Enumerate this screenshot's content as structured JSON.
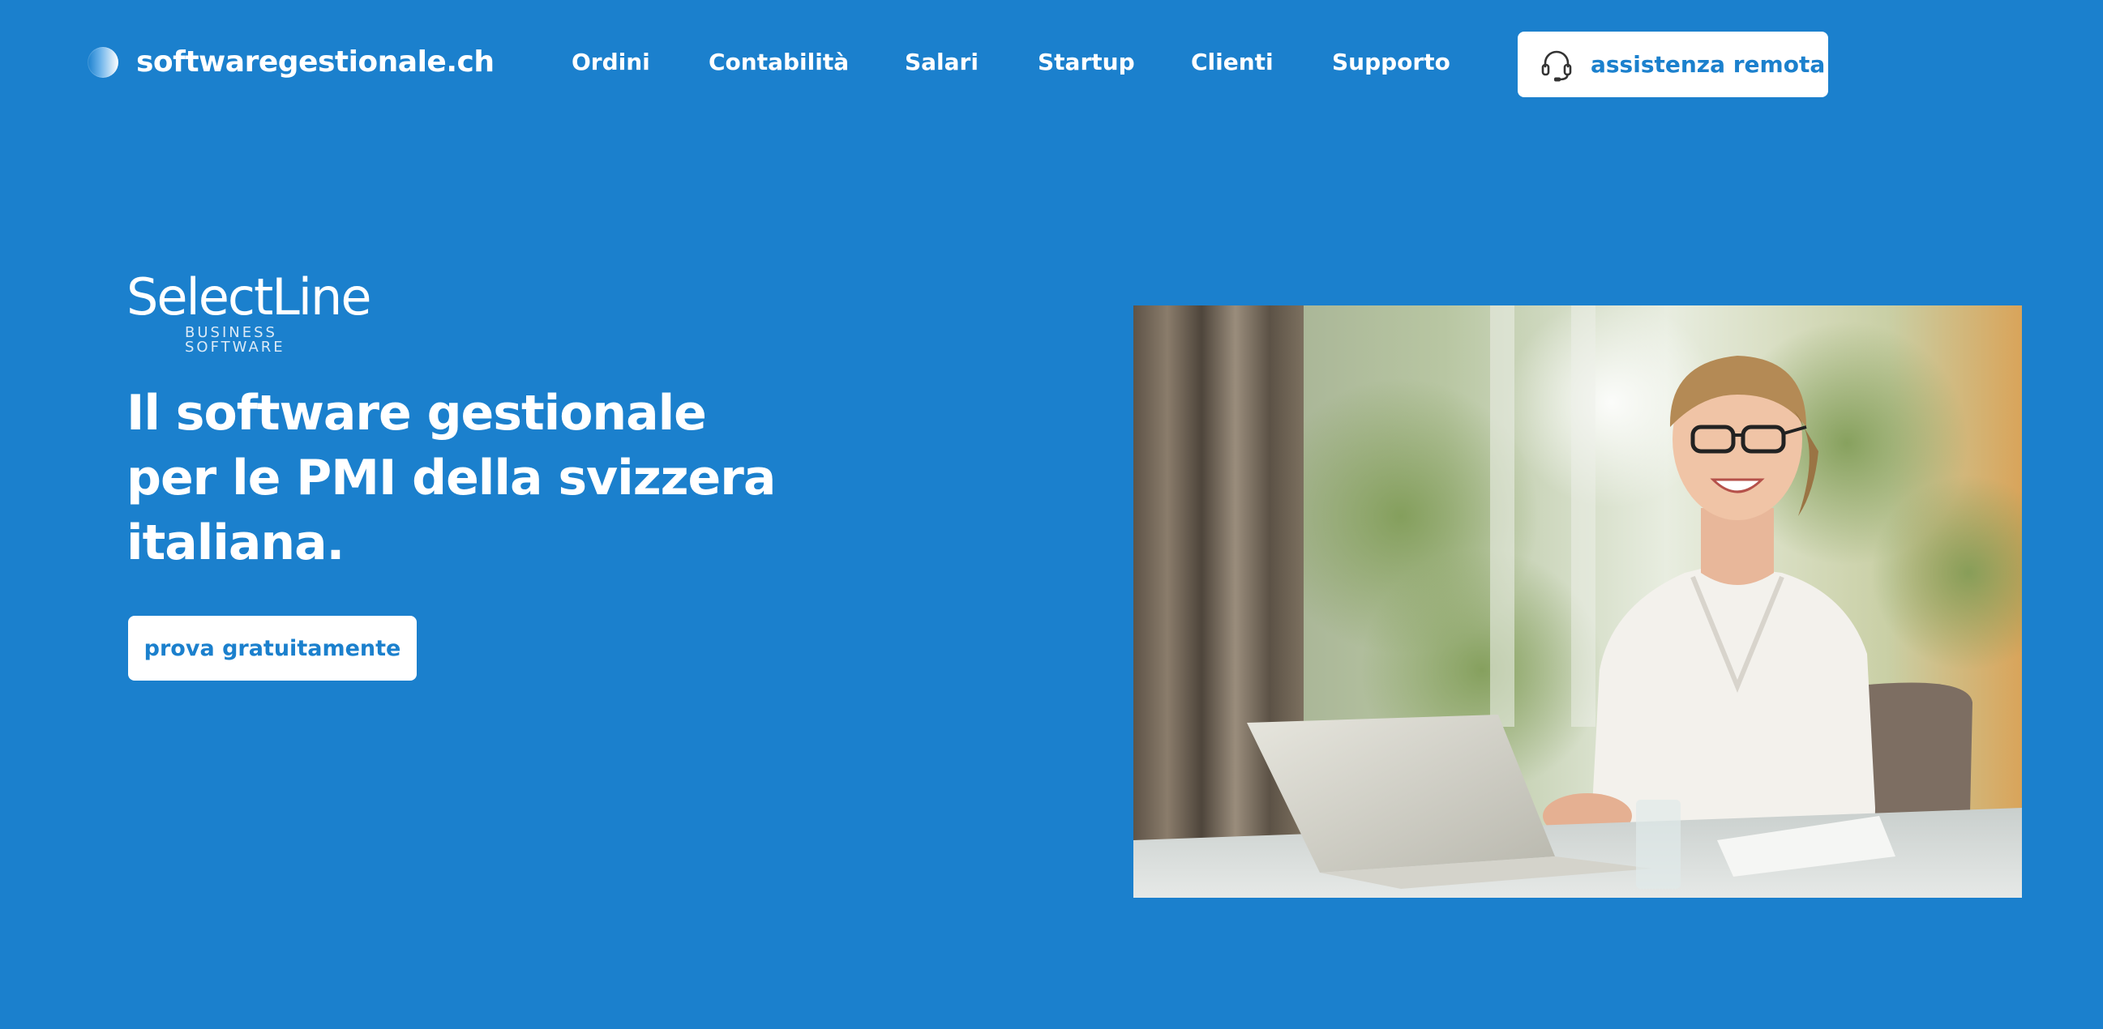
{
  "header": {
    "brand": "softwaregestionale.ch",
    "nav": [
      {
        "label": "Ordini"
      },
      {
        "label": "Contabilità"
      },
      {
        "label": "Salari"
      },
      {
        "label": "Startup"
      },
      {
        "label": "Clienti"
      },
      {
        "label": "Supporto"
      }
    ],
    "assist_button": {
      "label": "assistenza remota",
      "icon": "headset-icon"
    }
  },
  "hero": {
    "logo_wordmark": "SelectLine",
    "logo_tagline": "BUSINESS SOFTWARE",
    "headline_lines": [
      "Il software gestionale",
      "per le PMI della svizzera",
      "italiana."
    ],
    "cta_label": "prova gratuitamente",
    "photo_alt": "woman-laughing-at-laptop"
  },
  "colors": {
    "background": "#1b80cd",
    "button_bg": "#ffffff",
    "button_text": "#1b80cd"
  }
}
